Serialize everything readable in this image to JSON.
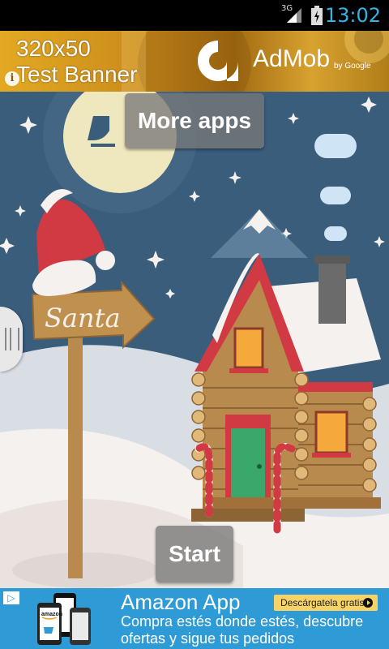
{
  "status_bar": {
    "network": "3G",
    "time": "13:02"
  },
  "top_ad": {
    "line1": "320x50",
    "line2": "Test Banner",
    "brand": "AdMob",
    "by": "by Google"
  },
  "scene": {
    "sign_text": "Santa"
  },
  "buttons": {
    "more_apps": "More apps",
    "start": "Start"
  },
  "bottom_ad": {
    "title": "Amazon App",
    "cta": "Descárgatela gratis",
    "description": "Compra estés donde estés, descubre ofertas y sigue tus pedidos",
    "phone_brand": "amazon"
  },
  "colors": {
    "sky": "#3a5d7c",
    "moon": "#efe7bd",
    "snow": "#f4f1ee",
    "roof_red": "#d13a42",
    "wood": "#b98a4e",
    "door_green": "#3aa86b",
    "status_accent": "#33b5e5",
    "ad_blue": "#2e9bd6"
  }
}
